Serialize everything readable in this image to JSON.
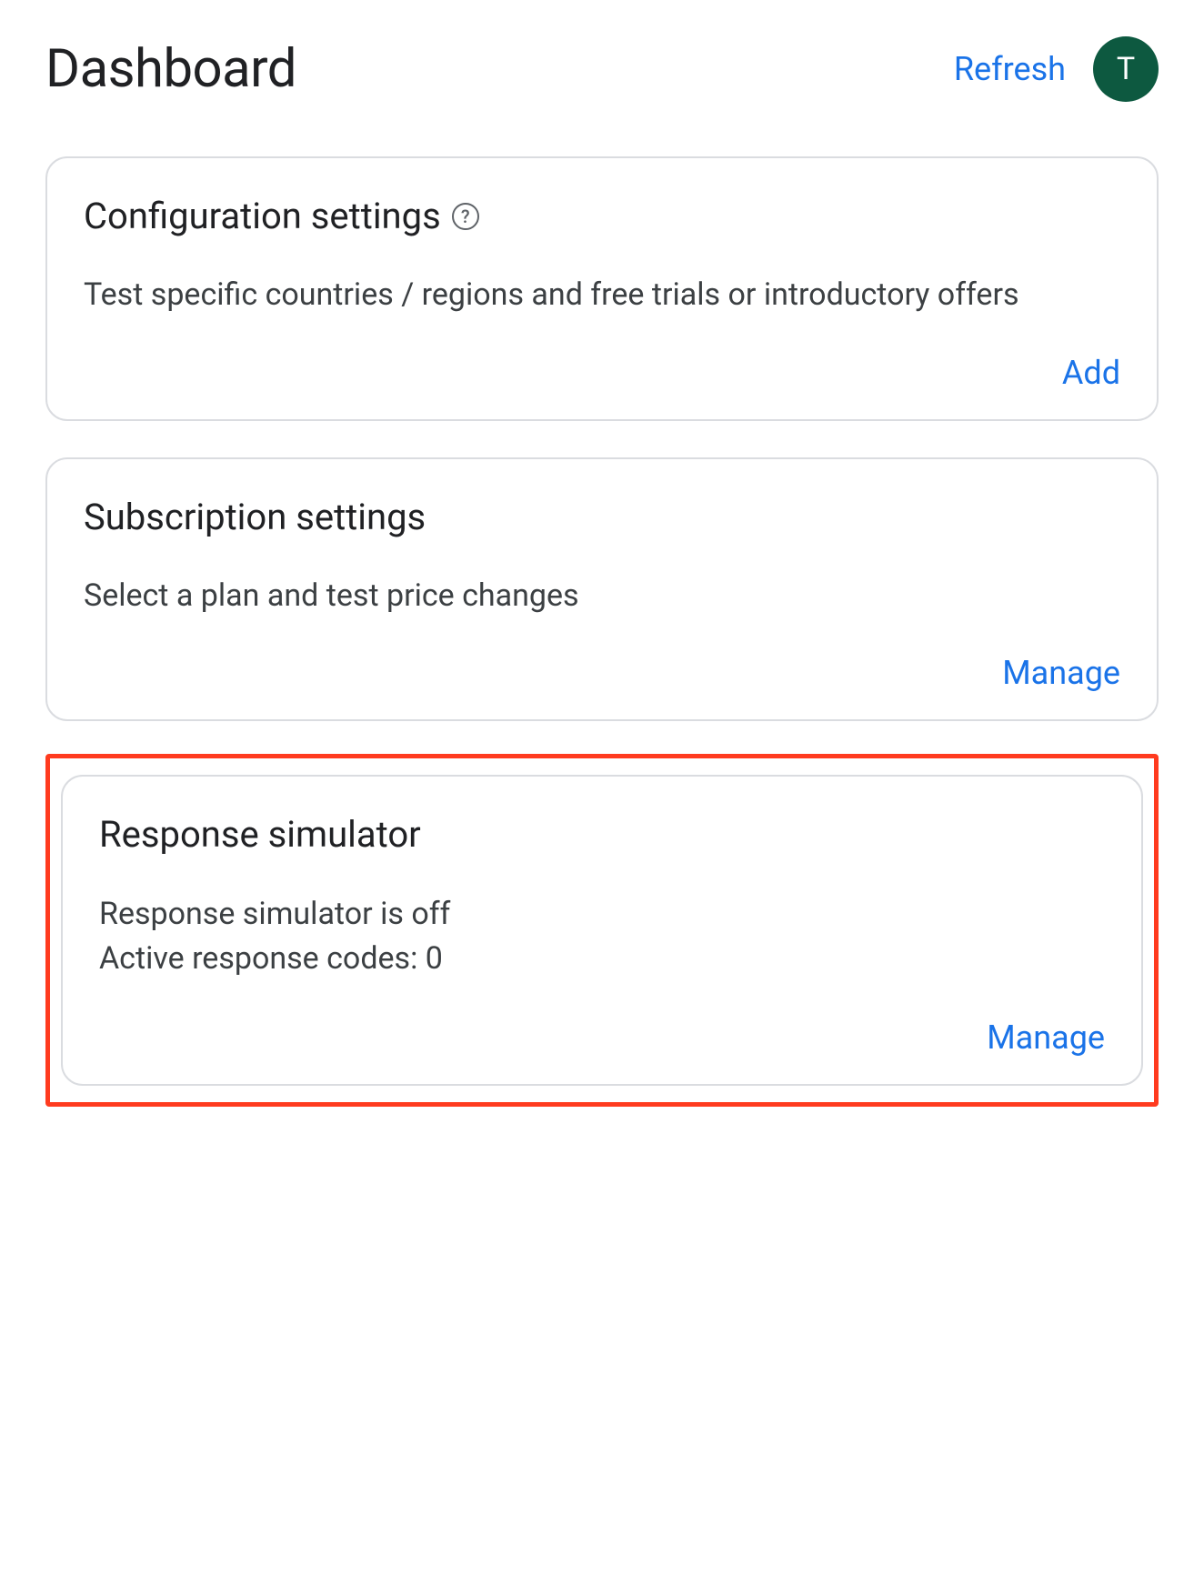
{
  "header": {
    "title": "Dashboard",
    "refresh_label": "Refresh",
    "avatar_initial": "T"
  },
  "cards": {
    "configuration": {
      "title": "Configuration settings",
      "description": "Test specific countries / regions and free trials or introductory offers",
      "action_label": "Add"
    },
    "subscription": {
      "title": "Subscription settings",
      "description": "Select a plan and test price changes",
      "action_label": "Manage"
    },
    "response_simulator": {
      "title": "Response simulator",
      "status_line": "Response simulator is off",
      "codes_line": "Active response codes: 0",
      "action_label": "Manage"
    }
  }
}
